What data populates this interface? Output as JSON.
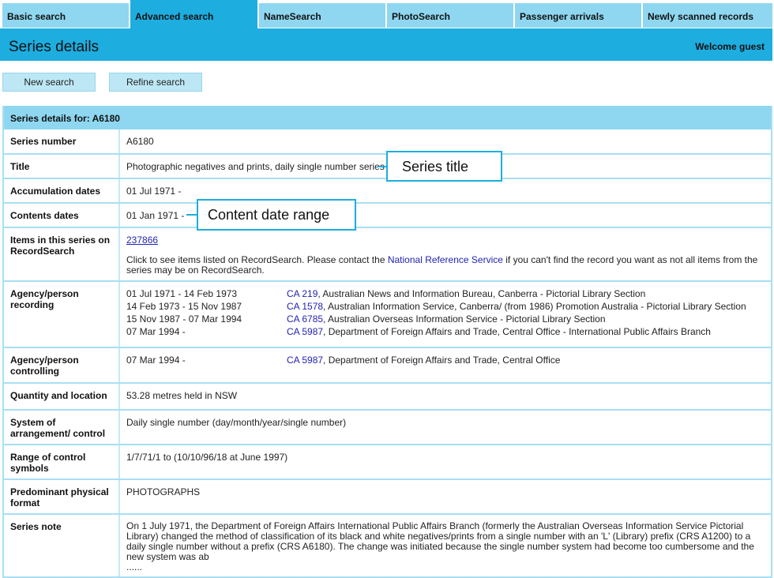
{
  "tabs": [
    {
      "label": "Basic search",
      "active": false
    },
    {
      "label": "Advanced search",
      "active": true
    },
    {
      "label": "NameSearch",
      "active": false
    },
    {
      "label": "PhotoSearch",
      "active": false
    },
    {
      "label": "Passenger arrivals",
      "active": false
    },
    {
      "label": "Newly scanned records",
      "active": false
    }
  ],
  "header": {
    "title": "Series details",
    "welcome": "Welcome guest"
  },
  "buttons": {
    "new_search": "New search",
    "refine_search": "Refine search"
  },
  "details": {
    "caption": "Series details for: A6180",
    "series_number": {
      "label": "Series number",
      "value": "A6180"
    },
    "title": {
      "label": "Title",
      "value": "Photographic negatives and prints, daily single number series"
    },
    "accumulation_dates": {
      "label": "Accumulation dates",
      "value": "01 Jul 1971 -"
    },
    "contents_dates": {
      "label": "Contents dates",
      "value": "01 Jan 1971 -"
    },
    "items": {
      "label": "Items in this series on RecordSearch",
      "count_link": "237866",
      "note_before": "Click to see items listed on RecordSearch. Please contact the ",
      "note_link": "National Reference Service",
      "note_after": " if you can't find the record you want as not all items from the series may be on RecordSearch."
    },
    "agency_recording": {
      "label": "Agency/person recording",
      "entries": [
        {
          "dates": "01 Jul 1971 - 14 Feb 1973",
          "code": "CA 219",
          "name": ", Australian News and Information Bureau, Canberra - Pictorial Library Section"
        },
        {
          "dates": "14 Feb 1973 - 15 Nov 1987",
          "code": "CA 1578",
          "name": ", Australian Information Service, Canberra/ (from 1986) Promotion Australia - Pictorial Library Section"
        },
        {
          "dates": "15 Nov 1987 - 07 Mar 1994",
          "code": "CA 6785",
          "name": ", Australian Overseas Information Service - Pictorial Library Section"
        },
        {
          "dates": "07 Mar 1994 -",
          "code": "CA 5987",
          "name": ", Department of Foreign Affairs and Trade, Central Office - International Public Affairs Branch"
        }
      ]
    },
    "agency_controlling": {
      "label": "Agency/person controlling",
      "entries": [
        {
          "dates": "07 Mar 1994 -",
          "code": "CA 5987",
          "name": ", Department of Foreign Affairs and Trade, Central Office"
        }
      ]
    },
    "quantity": {
      "label": "Quantity and location",
      "value": "53.28 metres held in NSW"
    },
    "system": {
      "label": "System of arrangement/ control",
      "value": "Daily single number (day/month/year/single number)"
    },
    "range": {
      "label": "Range of control symbols",
      "value": "1/7/71/1 to (10/10/96/18 at June 1997)"
    },
    "format": {
      "label": "Predominant physical format",
      "value": "PHOTOGRAPHS"
    },
    "series_note": {
      "label": "Series note",
      "value": "On 1 July 1971, the Department of Foreign Affairs International Public Affairs Branch (formerly the Australian Overseas Information Service Pictorial Library) changed the method of classification of its black and white negatives/prints from a single number with an 'L' (Library) prefix (CRS A1200) to a daily single number without a prefix (CRS A6180). The change was initiated because the single number system had become too cumbersome and the new system was ab",
      "ellipsis": "......"
    }
  },
  "callouts": {
    "series_title": "Series title",
    "content_date_range": "Content date range"
  },
  "colors": {
    "tab_inactive": "#8fd7f0",
    "tab_active": "#1eaddf",
    "header": "#1eaddf",
    "button": "#bde7f5",
    "border": "#a8dff2",
    "link": "#2323b5"
  }
}
